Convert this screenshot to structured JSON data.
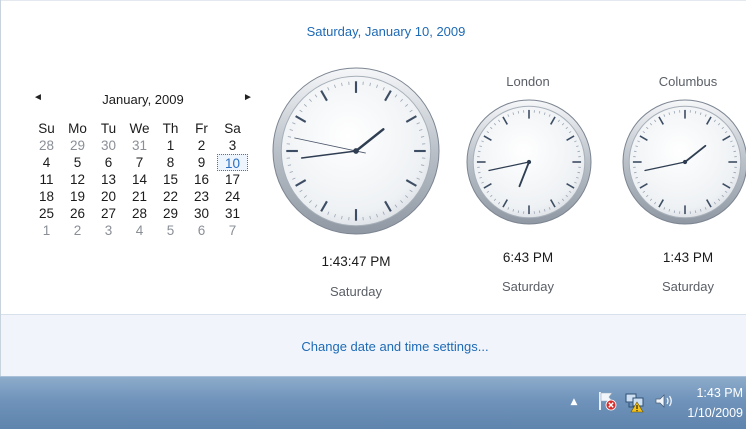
{
  "flyout": {
    "date_header": "Saturday, January 10, 2009",
    "footer_link": "Change date and time settings..."
  },
  "calendar": {
    "prev_icon": "◄",
    "next_icon": "►",
    "month_label": "January, 2009",
    "weekdays": [
      "Su",
      "Mo",
      "Tu",
      "We",
      "Th",
      "Fr",
      "Sa"
    ],
    "weeks": [
      [
        "28",
        "29",
        "30",
        "31",
        "1",
        "2",
        "3"
      ],
      [
        "4",
        "5",
        "6",
        "7",
        "8",
        "9",
        "10"
      ],
      [
        "11",
        "12",
        "13",
        "14",
        "15",
        "16",
        "17"
      ],
      [
        "18",
        "19",
        "20",
        "21",
        "22",
        "23",
        "24"
      ],
      [
        "25",
        "26",
        "27",
        "28",
        "29",
        "30",
        "31"
      ],
      [
        "1",
        "2",
        "3",
        "4",
        "5",
        "6",
        "7"
      ]
    ],
    "outside_month": [
      [
        true,
        true,
        true,
        true,
        false,
        false,
        false
      ],
      [
        false,
        false,
        false,
        false,
        false,
        false,
        false
      ],
      [
        false,
        false,
        false,
        false,
        false,
        false,
        false
      ],
      [
        false,
        false,
        false,
        false,
        false,
        false,
        false
      ],
      [
        false,
        false,
        false,
        false,
        false,
        false,
        false
      ],
      [
        true,
        true,
        true,
        true,
        true,
        true,
        true
      ]
    ],
    "today": "10"
  },
  "clocks": [
    {
      "city": "",
      "time": "1:43:47 PM",
      "day": "Saturday",
      "hour": 13,
      "minute": 43,
      "second": 47
    },
    {
      "city": "London",
      "time": "6:43 PM",
      "day": "Saturday",
      "hour": 18,
      "minute": 43
    },
    {
      "city": "Columbus",
      "time": "1:43 PM",
      "day": "Saturday",
      "hour": 13,
      "minute": 43
    }
  ],
  "taskbar": {
    "show_hidden_icon": "▲",
    "action_center_icon": "flag-error-icon",
    "network_icon": "network-warning-icon",
    "volume_icon": "speaker-icon",
    "clock_time": "1:43 PM",
    "clock_date": "1/10/2009"
  },
  "colors": {
    "link": "#1e6ab5",
    "taskbar_top": "#8eaccb",
    "taskbar_bottom": "#5f84ad",
    "today_border": "#3a78c0"
  }
}
